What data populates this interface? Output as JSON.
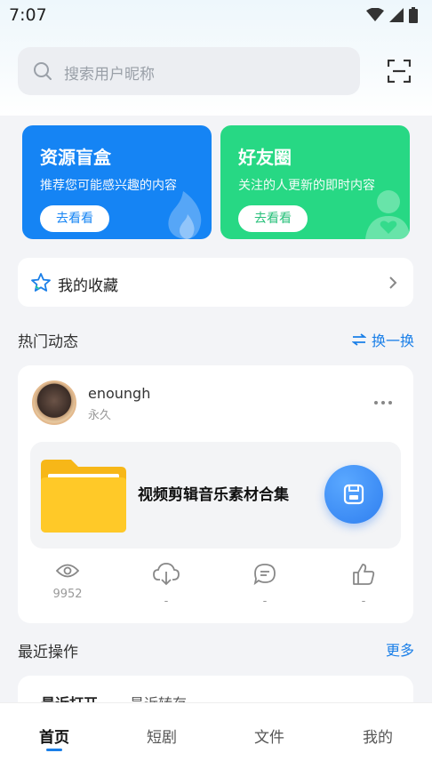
{
  "status_bar": {
    "time": "7:07"
  },
  "search": {
    "placeholder": "搜索用户昵称"
  },
  "cards": [
    {
      "title": "资源盲盒",
      "subtitle": "推荐您可能感兴趣的内容",
      "button": "去看看",
      "color": "#1584f4"
    },
    {
      "title": "好友圈",
      "subtitle": "关注的人更新的即时内容",
      "button": "去看看",
      "color": "#27d884"
    }
  ],
  "favorites": {
    "label": "我的收藏"
  },
  "hot": {
    "title": "热门动态",
    "refresh_label": "换一换",
    "post": {
      "username": "enoungh",
      "tag": "永久",
      "file_title": "视频剪辑音乐素材合集",
      "stats": {
        "views": "9952",
        "downloads": "-",
        "comments": "-",
        "likes": "-"
      }
    }
  },
  "recent": {
    "title": "最近操作",
    "more_label": "更多",
    "tabs": [
      "最近打开",
      "最近转存"
    ]
  },
  "bottom_nav": {
    "items": [
      "首页",
      "短剧",
      "文件",
      "我的"
    ],
    "active_index": 0
  },
  "colors": {
    "accent": "#1a7fe8",
    "blue_card": "#1584f4",
    "green_card": "#27d884",
    "folder": "#ffc928"
  }
}
